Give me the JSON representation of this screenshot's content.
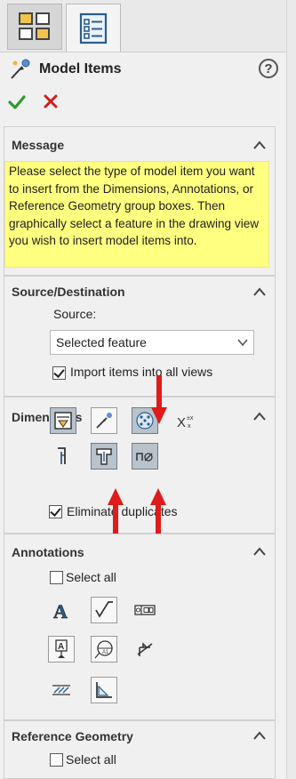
{
  "header": {
    "title": "Model Items",
    "help_symbol": "?"
  },
  "icons": {
    "tab_1": "feature-manager-tree-icon",
    "tab_2": "property-manager-icon",
    "header": "model-items-icon",
    "ok": "checkmark-icon",
    "cancel": "close-icon"
  },
  "colors": {
    "message_bg": "#ffff80",
    "ok": "#2d9b2d",
    "cancel": "#d21e1e",
    "arrow": "#e01b1b",
    "active_tool": "#b9c3cc"
  },
  "message": {
    "title": "Message",
    "text": "Please select the type of model item you want to insert from the Dimensions, Annotations, or Reference Geometry group boxes. Then graphically select a feature in the drawing view you wish to insert model items into."
  },
  "source_destination": {
    "title": "Source/Destination",
    "source_label": "Source:",
    "source_value": "Selected feature",
    "import_label": "Import items into all views",
    "import_checked": true
  },
  "dimensions": {
    "title": "Dimensions",
    "tools": [
      "marked-for-drawing-icon",
      "not-marked-for-drawing-icon",
      "instance-count-icon",
      "tolerance-dimension-icon",
      "hole-wizard-profile-icon",
      "hole-wizard-locations-icon",
      "hole-callout-icon"
    ],
    "eliminate_label": "Eliminate duplicates",
    "eliminate_checked": true
  },
  "annotations": {
    "title": "Annotations",
    "select_all_label": "Select all",
    "select_all_checked": false,
    "tools": [
      "note-icon",
      "surface-finish-icon",
      "geometric-tolerance-icon",
      "datum-feature-icon",
      "datum-target-icon",
      "weld-symbol-icon",
      "cosmetic-thread-icon",
      "caterpillar-end-treatment-icon"
    ]
  },
  "reference_geometry": {
    "title": "Reference Geometry",
    "select_all_label": "Select all",
    "select_all_checked": false
  }
}
